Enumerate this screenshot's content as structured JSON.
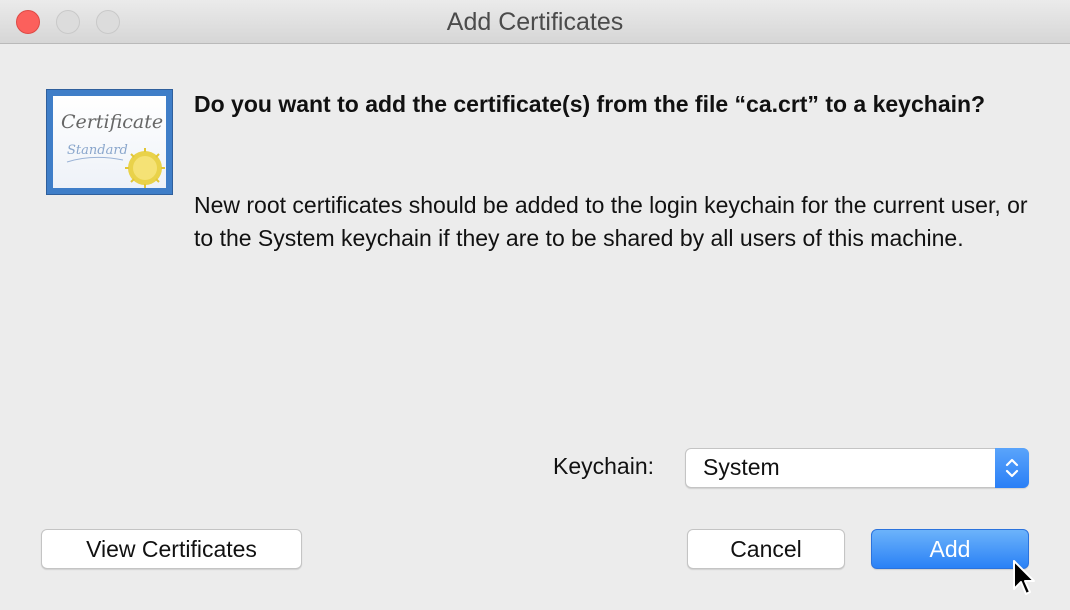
{
  "window": {
    "title": "Add Certificates"
  },
  "certificate_icon": {
    "line1": "Certificate",
    "line2": "Standard"
  },
  "dialog": {
    "heading": "Do you want to add the certificate(s) from the file “ca.crt” to a keychain?",
    "message": "New root certificates should be added to the login keychain for the current user, or to the System keychain if they are to be shared by all users of this machine."
  },
  "keychain": {
    "label": "Keychain:",
    "selected": "System"
  },
  "buttons": {
    "view_certificates": "View Certificates",
    "cancel": "Cancel",
    "add": "Add"
  },
  "colors": {
    "accent": "#2a81f6",
    "close": "#fc605c",
    "background": "#ececec"
  }
}
